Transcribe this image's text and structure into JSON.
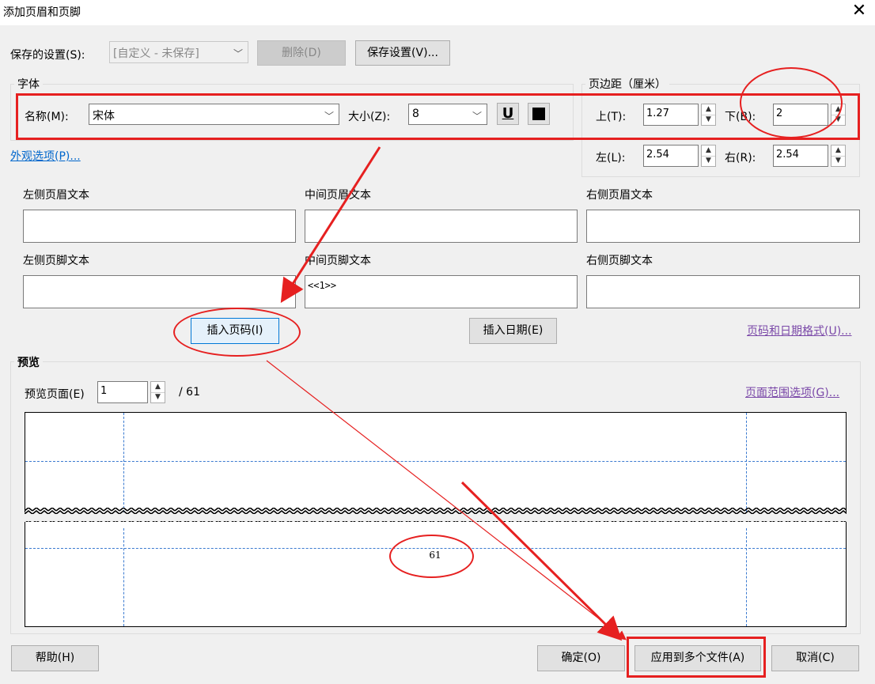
{
  "window": {
    "title": "添加页眉和页脚",
    "close_glyph": "✕"
  },
  "saved_settings": {
    "label": "保存的设置(S):",
    "value": "[自定义 - 未保存]",
    "delete_label": "删除(D)",
    "save_label": "保存设置(V)..."
  },
  "font": {
    "group_title": "字体",
    "name_label": "名称(M):",
    "name_value": "宋体",
    "size_label": "大小(Z):",
    "size_value": "8",
    "underline_glyph": "U"
  },
  "appearance_link": "外观选项(P)...",
  "margins": {
    "group_title": "页边距（厘米）",
    "top_label": "上(T):",
    "top_value": "1.27",
    "bottom_label": "下(B):",
    "bottom_value": "2",
    "left_label": "左(L):",
    "left_value": "2.54",
    "right_label": "右(R):",
    "right_value": "2.54"
  },
  "header_footer": {
    "left_header_label": "左侧页眉文本",
    "center_header_label": "中间页眉文本",
    "right_header_label": "右侧页眉文本",
    "left_footer_label": "左侧页脚文本",
    "center_footer_label": "中间页脚文本",
    "right_footer_label": "右侧页脚文本",
    "center_footer_value": "<<1>>"
  },
  "insert_page_label": "插入页码(I)",
  "insert_date_label": "插入日期(E)",
  "format_link": "页码和日期格式(U)...",
  "preview": {
    "group_title": "预览",
    "page_label": "预览页面(E)",
    "page_value": "1",
    "total": "/ 61",
    "range_link": "页面范围选项(G)...",
    "footer_number": "61"
  },
  "buttons": {
    "help": "帮助(H)",
    "ok": "确定(O)",
    "apply_multiple": "应用到多个文件(A)",
    "cancel": "取消(C)"
  },
  "colors": {
    "annotation_red": "#e62020",
    "guide_blue": "#3a7ad0",
    "link_blue": "#0066cc"
  }
}
